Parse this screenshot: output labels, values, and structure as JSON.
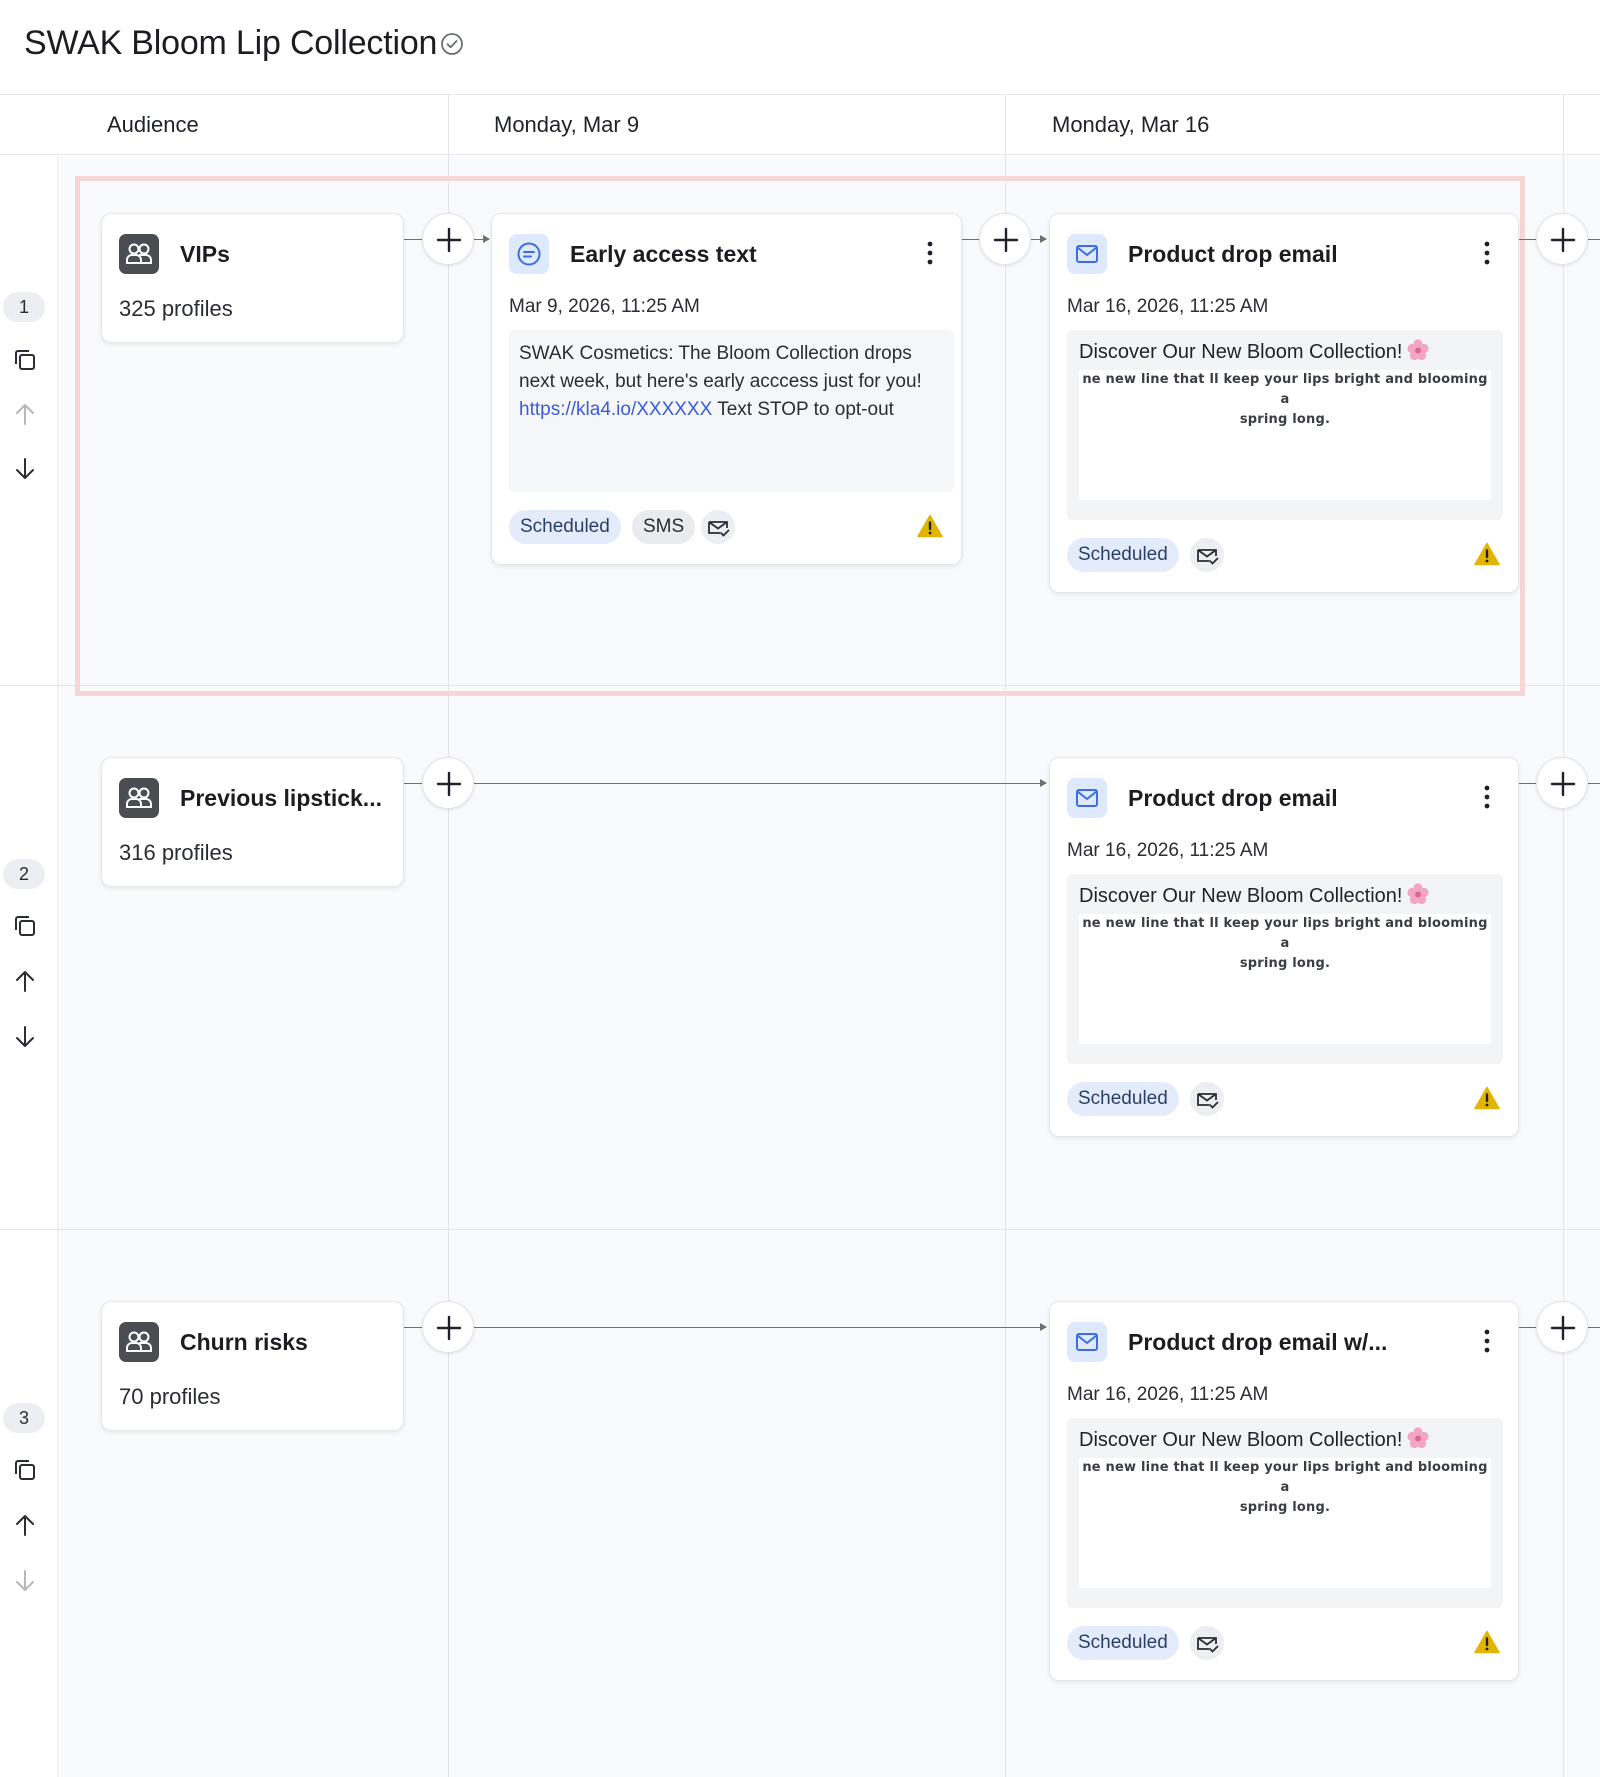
{
  "campaign": {
    "title": "SWAK Bloom Lip Collection"
  },
  "columns": {
    "audience": "Audience",
    "week1": "Monday, Mar 9",
    "week2": "Monday, Mar 16"
  },
  "rows": [
    {
      "number": "1",
      "audience": {
        "name": "VIPs",
        "count": "325 profiles"
      },
      "sms": {
        "title": "Early access text",
        "date": "Mar 9, 2026, 11:25 AM",
        "body_before": "SWAK Cosmetics: The Bloom Collection drops next week, but here's early acccess just for you! ",
        "link": "https://kla4.io/XXXXXX",
        "body_after": " Text STOP to opt-out",
        "status": "Scheduled",
        "channel": "SMS"
      },
      "email": {
        "title": "Product drop email",
        "date": "Mar 16, 2026, 11:25 AM",
        "preview_heading": "Discover Our New Bloom Collection!",
        "preview_line1": "ne new line that ll keep your lips bright and blooming a",
        "preview_line2": "spring long.",
        "status": "Scheduled"
      }
    },
    {
      "number": "2",
      "audience": {
        "name": "Previous lipstick...",
        "count": "316 profiles"
      },
      "email": {
        "title": "Product drop email",
        "date": "Mar 16, 2026, 11:25 AM",
        "preview_heading": "Discover Our New Bloom Collection!",
        "preview_line1": "ne new line that ll keep your lips bright and blooming a",
        "preview_line2": "spring long.",
        "status": "Scheduled"
      }
    },
    {
      "number": "3",
      "audience": {
        "name": "Churn risks",
        "count": "70 profiles"
      },
      "email": {
        "title": "Product drop email w/...",
        "date": "Mar 16, 2026, 11:25 AM",
        "preview_heading": "Discover Our New Bloom Collection!",
        "preview_line1": "ne new line that ll keep your lips bright and blooming a",
        "preview_line2": "spring long.",
        "status": "Scheduled"
      }
    }
  ],
  "colors": {
    "highlight": "#f7d6da",
    "link": "#3b5bdb",
    "pill_scheduled": "#e4ecfb",
    "warning": "#e0b400"
  }
}
